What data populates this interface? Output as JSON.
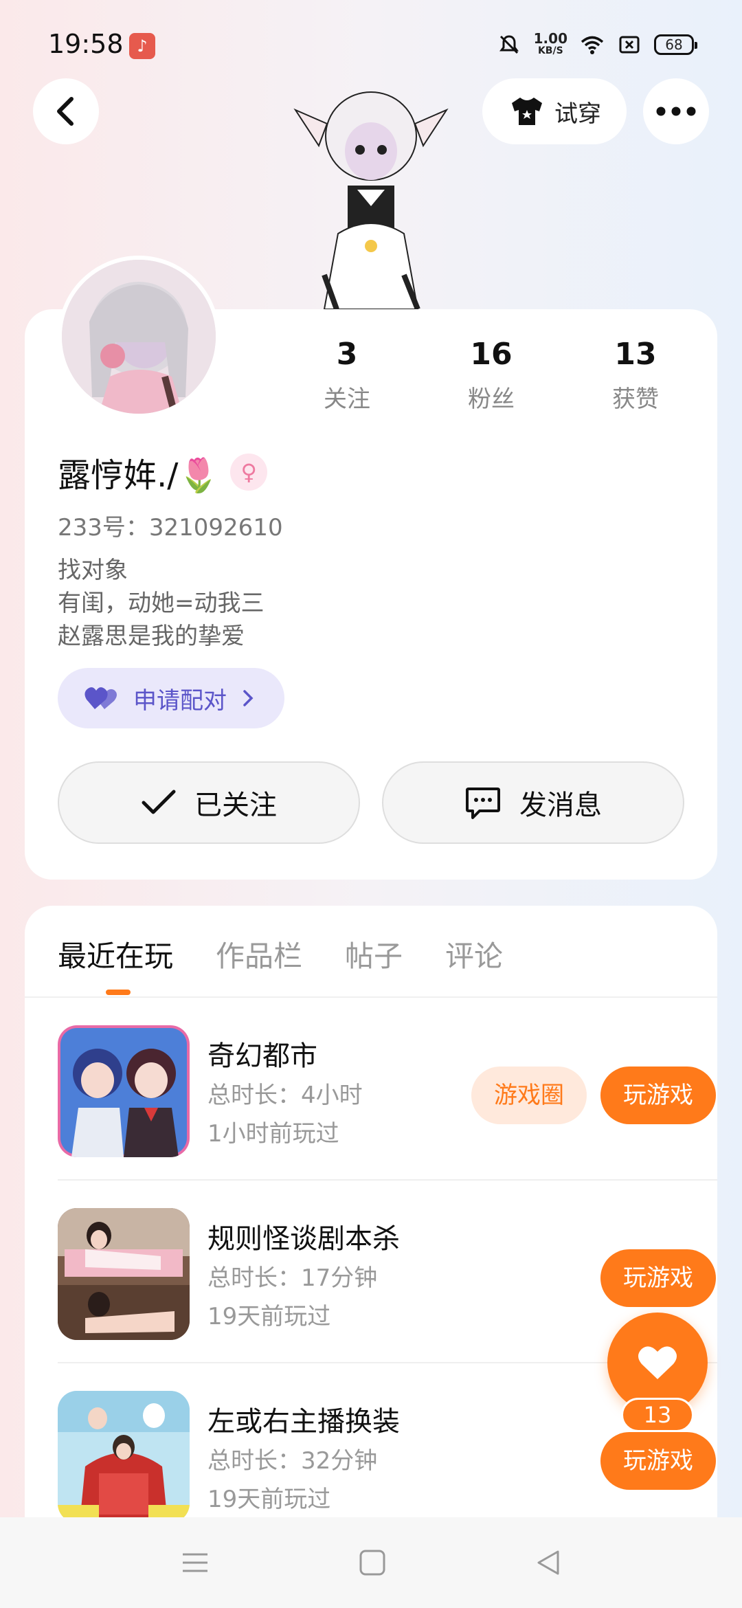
{
  "status_bar": {
    "time": "19:58",
    "net_speed_value": "1.00",
    "net_speed_unit": "KB/S",
    "battery": "68",
    "music_icon": "music-note-icon"
  },
  "header": {
    "tryon_label": "试穿"
  },
  "profile": {
    "stats": [
      {
        "value": "3",
        "label": "关注"
      },
      {
        "value": "16",
        "label": "粉丝"
      },
      {
        "value": "13",
        "label": "获赞"
      }
    ],
    "username": "露悙姩./🌷",
    "gender_symbol": "♀",
    "user_id": "233号：321092610",
    "bio": [
      "找对象",
      "有闺，动她=动我三",
      "赵露思是我的挚爱"
    ],
    "pair_label": "申请配对",
    "follow_label": "已关注",
    "message_label": "发消息"
  },
  "tabs": [
    "最近在玩",
    "作品栏",
    "帖子",
    "评论"
  ],
  "games": [
    {
      "title": "奇幻都市",
      "duration": "总时长：4小时",
      "played": "1小时前玩过",
      "circle": "游戏圈",
      "play": "玩游戏"
    },
    {
      "title": "规则怪谈剧本杀",
      "duration": "总时长：17分钟",
      "played": "19天前玩过",
      "play": "玩游戏"
    },
    {
      "title": "左或右主播换装",
      "duration": "总时长：32分钟",
      "played": "19天前玩过",
      "play": "玩游戏"
    }
  ],
  "like_count": "13",
  "colors": {
    "accent": "#ff7a1a",
    "pair": "#5b55c9"
  }
}
